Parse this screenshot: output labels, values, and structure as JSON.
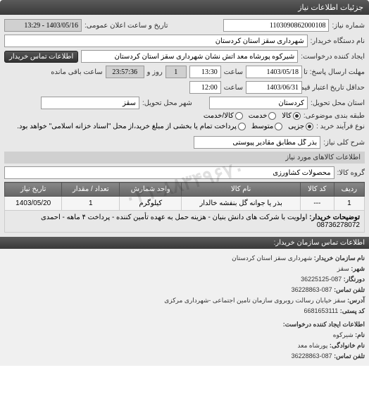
{
  "header": {
    "title": "جزئیات اطلاعات نیاز"
  },
  "fields": {
    "need_number_label": "شماره نیاز:",
    "need_number": "1103090862000108",
    "announce_label": "تاریخ و ساعت اعلان عمومی:",
    "announce_value": "1403/05/16 - 13:29",
    "buyer_org_label": "نام دستگاه خریدار:",
    "buyer_org": "شهرداری سقز استان کردستان",
    "requester_label": "ایجاد کننده درخواست:",
    "requester": "شیرکوه پورشاه معد آتش نشان شهرداری سقز استان کردستان",
    "contact_btn": "اطلاعات تماس خریدار",
    "deadline_label": "مهلت ارسال پاسخ: تا تاریخ:",
    "deadline_date": "1403/05/18",
    "time_label": "ساعت",
    "deadline_time": "13:30",
    "remain_days": "1",
    "remain_days_label": "روز و",
    "remain_time": "23:57:36",
    "remain_label": "ساعت باقی مانده",
    "validity_label": "حداقل تاریخ اعتبار قیمت: تا تاریخ:",
    "validity_date": "1403/06/31",
    "validity_time": "12:00",
    "province_label": "استان محل تحویل:",
    "province": "کردستان",
    "city_label": "شهر محل تحویل:",
    "city": "سقز",
    "category_label": "طبقه بندی موضوعی:",
    "cat_goods": "کالا",
    "cat_service": "خدمت",
    "cat_goods_service": "کالا/خدمت",
    "purchase_type_label": "نوع فرآیند خرید :",
    "pt_small": "جزیی",
    "pt_medium": "متوسط",
    "pt_note": "پرداخت تمام یا بخشی از مبلغ خرید،از محل \"اسناد خزانه اسلامی\" خواهد بود.",
    "desc_label": "شرح کلی نیاز:",
    "desc_value": "بذر گل مطابق مقادیر پیوستی",
    "items_header": "اطلاعات کالاهای مورد نیاز",
    "group_label": "گروه کالا:",
    "group_value": "محصولات کشاورزی"
  },
  "table": {
    "headers": {
      "row": "ردیف",
      "code": "کد کالا",
      "name": "نام کالا",
      "unit": "واحد شمارش",
      "qty": "تعداد / مقدار",
      "date": "تاریخ نیاز"
    },
    "rows": [
      {
        "row": "1",
        "code": "---",
        "name": "بذر یا جوانه گل بنفشه خالدار",
        "unit": "کیلوگرم",
        "qty": "1",
        "date": "1403/05/20"
      }
    ],
    "notes_label": "توضیحات خریدار:",
    "notes": "اولویت با شرکت های دانش بنیان - هزینه حمل به عهده تأمین کننده - پرداخت ۴ ماهه - احمدی 08736278072"
  },
  "contact": {
    "header": "اطلاعات تماس سازمان خریدار:",
    "org_label": "نام سازمان خریدار:",
    "org": "شهرداری سقز استان کردستان",
    "city_label": "شهر:",
    "city": "سقز",
    "fax_label": "دورنگار:",
    "fax": "087-36225125",
    "phone_label": "تلفن تماس:",
    "phone": "087-36228863",
    "address_label": "آدرس:",
    "address": "سقز خیابان رسالت روبروی سازمان تامین اجتماعی -شهرداری مرکزی",
    "postal_label": "کد پستی:",
    "postal": "6681653111",
    "req_header": "اطلاعات ایجاد کننده درخواست:",
    "req_name_label": "نام:",
    "req_name": "شیرکوه",
    "req_family_label": "نام خانوادگی:",
    "req_family": "پورشاه معد",
    "req_phone_label": "تلفن تماس:",
    "req_phone": "087-36228863"
  },
  "watermark": "۰۲۱-۸۸۳۴۹۶۷۰"
}
